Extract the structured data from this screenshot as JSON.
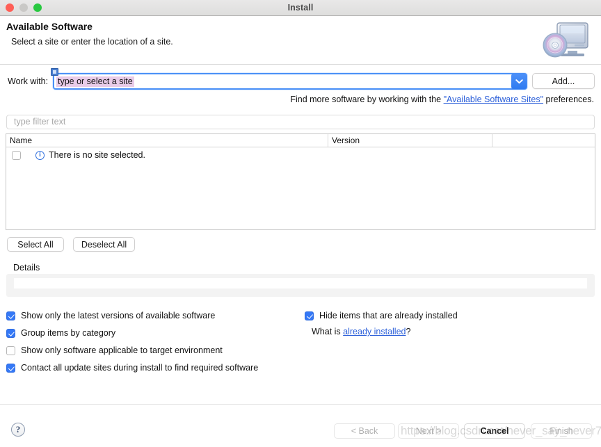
{
  "window": {
    "title": "Install",
    "traffic_lights": [
      "close-button",
      "minimize-button",
      "maximize-button"
    ]
  },
  "header": {
    "title": "Available Software",
    "subtitle": "Select a site or enter the location of a site.",
    "icon": "computer-with-disc-icon"
  },
  "work_with": {
    "label": "Work with:",
    "value": "type or select a site",
    "placeholder": "type or select a site",
    "dropdown_icon": "chevron-down-icon",
    "badge_icon": "site-badge-icon",
    "add_button": "Add..."
  },
  "find_more": {
    "prefix": "Find more software by working with the ",
    "link": "\"Available Software Sites\"",
    "suffix": " preferences."
  },
  "filter": {
    "placeholder": "type filter text",
    "value": ""
  },
  "table": {
    "columns": [
      "Name",
      "Version",
      ""
    ],
    "rows": [
      {
        "checked": false,
        "icon": "info-icon",
        "icon_glyph": "i",
        "name": "There is no site selected.",
        "version": ""
      }
    ]
  },
  "list_actions": {
    "select_all": "Select All",
    "deselect_all": "Deselect All"
  },
  "details": {
    "label": "Details",
    "text": ""
  },
  "options": {
    "left": [
      {
        "label": "Show only the latest versions of available software",
        "checked": true
      },
      {
        "label": "Group items by category",
        "checked": true
      },
      {
        "label": "Show only software applicable to target environment",
        "checked": false
      },
      {
        "label": "Contact all update sites during install to find required software",
        "checked": true
      }
    ],
    "right": [
      {
        "label": "Hide items that are already installed",
        "checked": true
      }
    ],
    "what_is": {
      "prefix": "What is ",
      "link": "already installed",
      "suffix": "?"
    }
  },
  "footer": {
    "help": "?",
    "buttons": [
      {
        "label": "< Back",
        "enabled": false
      },
      {
        "label": "Next >",
        "enabled": false
      },
      {
        "label": "Cancel",
        "enabled": true
      },
      {
        "label": "Finish",
        "enabled": false
      }
    ]
  },
  "watermark": "https://blog.csdn.net/never_say_never7",
  "colors": {
    "accent_blue": "#3478f6",
    "link_blue": "#2b5fd9",
    "selection_purple": "#e8cbe8",
    "titlebar_gray": "#e4e3e2"
  }
}
